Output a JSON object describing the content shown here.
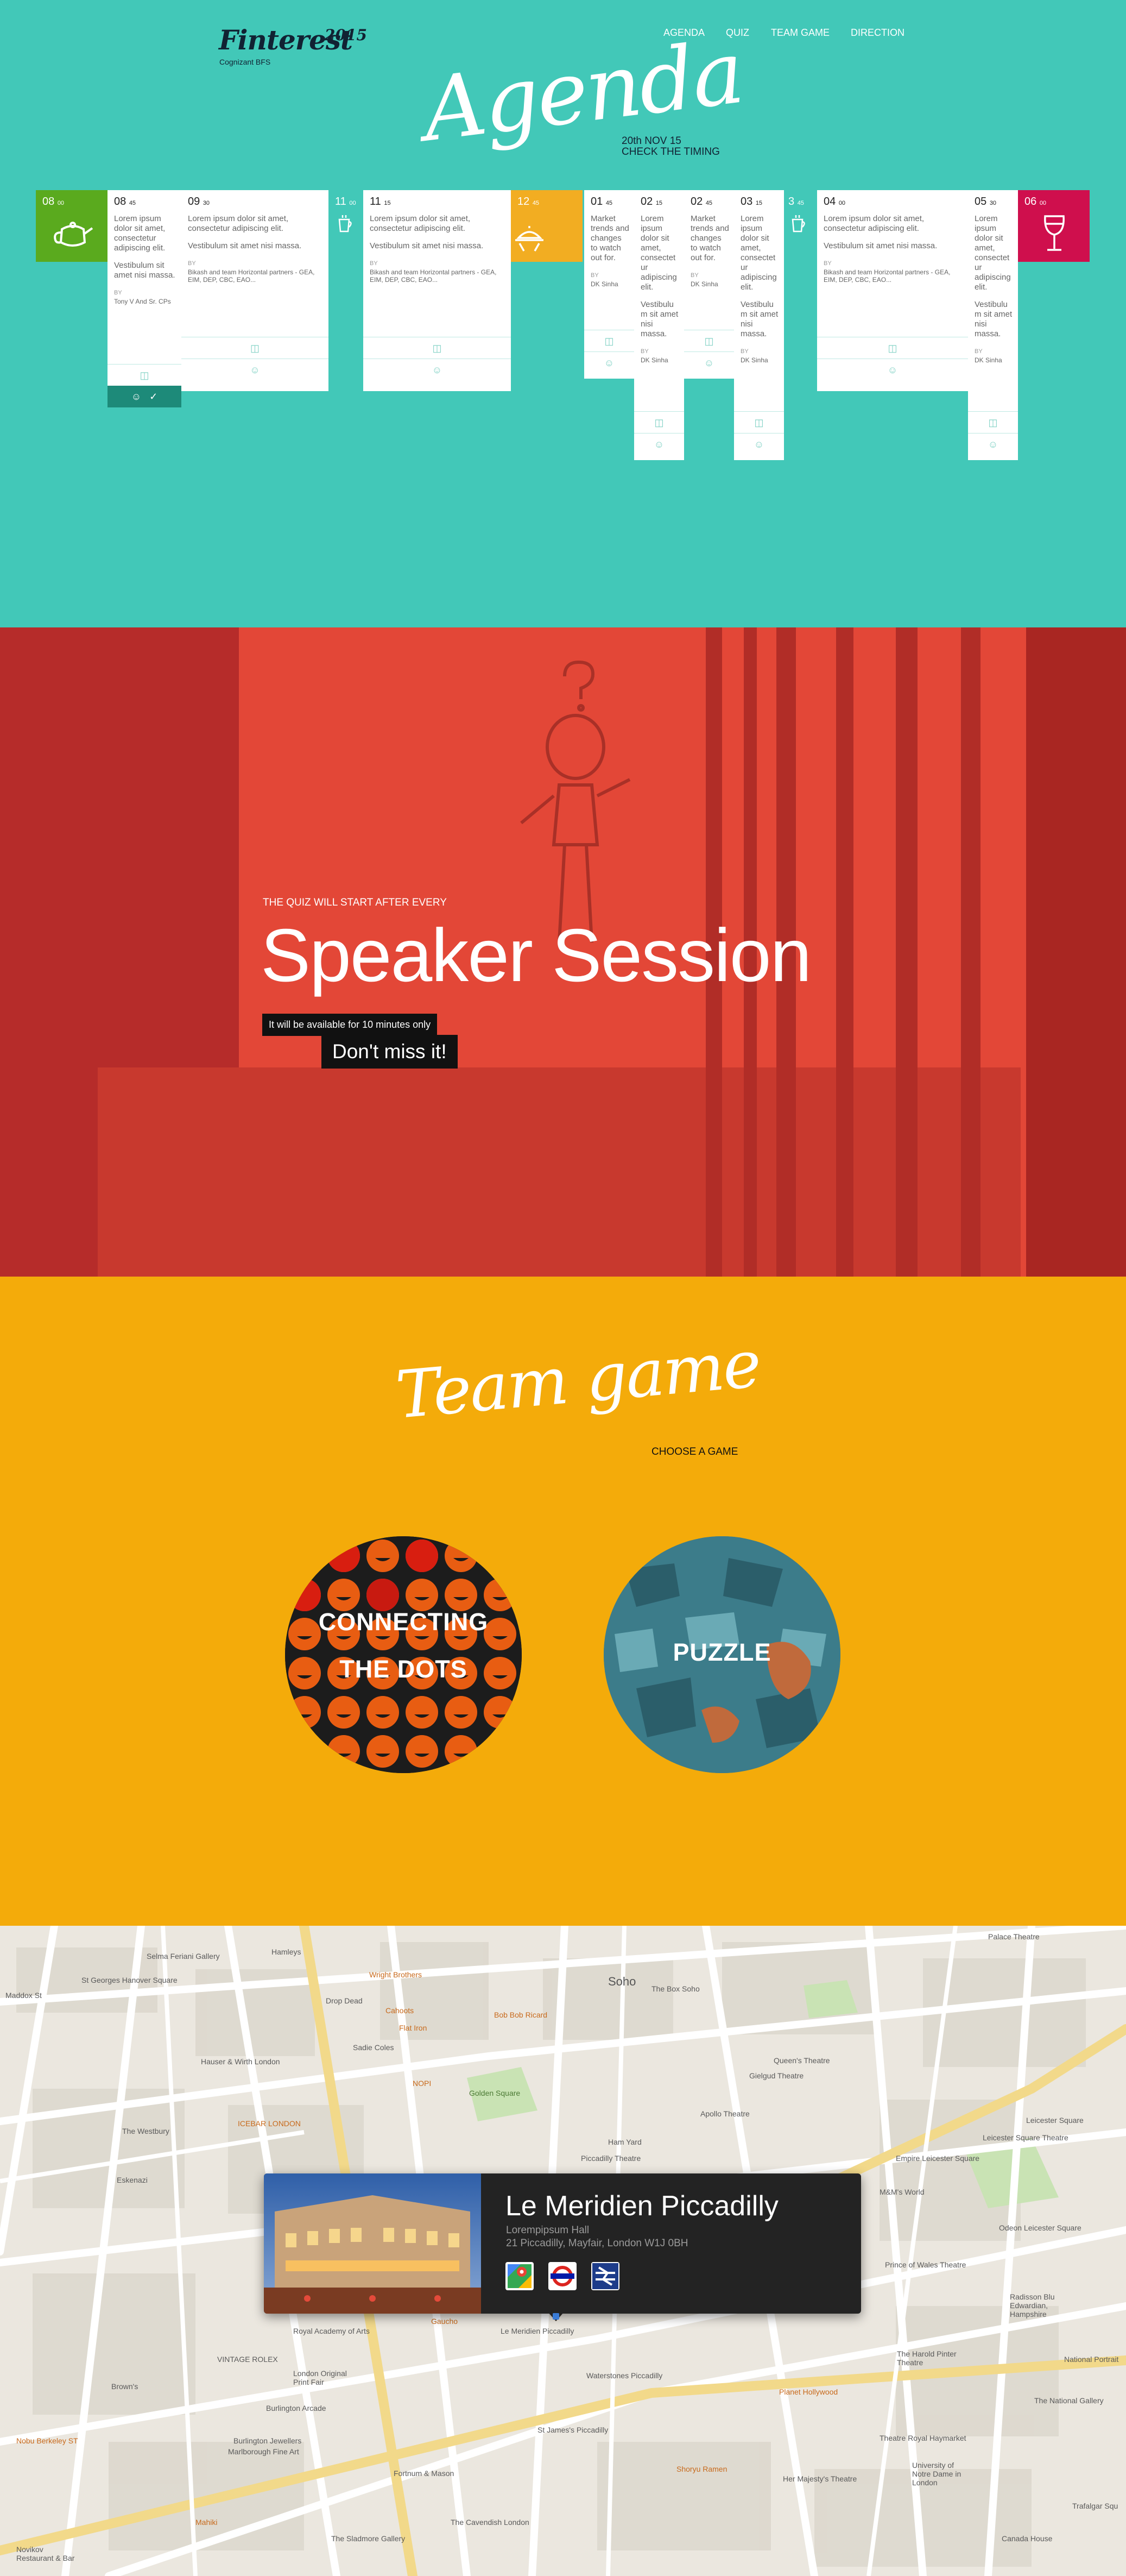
{
  "brand": {
    "logo": "Finterest",
    "year": "2015",
    "subtitle": "Cognizant BFS"
  },
  "nav": [
    "AGENDA",
    "QUIZ",
    "TEAM GAME",
    "DIRECTION"
  ],
  "agenda": {
    "title": "Agenda",
    "date_line1": "20th NOV 15",
    "date_line2": "CHECK THE TIMING",
    "breaks": [
      {
        "hour": "08",
        "min": "00",
        "icon": "teapot-icon",
        "color": "#5aaa1e"
      },
      {
        "hour": "11",
        "min": "00",
        "icon": "coffee-cup-icon"
      },
      {
        "hour": "12",
        "min": "45",
        "icon": "lunch-tray-icon",
        "color": "#f2ad22"
      },
      {
        "hour": "3",
        "min": "45",
        "icon": "coffee-cup-icon"
      },
      {
        "hour": "06",
        "min": "00",
        "icon": "wine-glass-icon",
        "color": "#cf0f4d"
      }
    ],
    "sessions": [
      {
        "hour": "08",
        "min": "45",
        "p1": "Lorem ipsum dolor sit amet, consectetur adipiscing elit.",
        "p2": "Vestibulum sit amet nisi massa.",
        "by": "BY",
        "speaker": "Tony V And Sr. CPs"
      },
      {
        "hour": "09",
        "min": "30",
        "p1": "Lorem ipsum dolor sit amet, consectetur adipiscing elit.",
        "p2": "Vestibulum sit amet nisi massa.",
        "by": "BY",
        "speaker": "Bikash and team Horizontal partners - GEA, EIM, DEP, CBC, EAO..."
      },
      {
        "hour": "11",
        "min": "15",
        "p1": "Lorem ipsum dolor sit amet, consectetur adipiscing elit.",
        "p2": "Vestibulum sit amet nisi massa.",
        "by": "BY",
        "speaker": "Bikash and team Horizontal partners - GEA, EIM, DEP, CBC, EAO..."
      },
      {
        "hour": "01",
        "min": "45",
        "p1": "Market trends and changes to watch out for.",
        "p2": "",
        "by": "BY",
        "speaker": "DK Sinha"
      },
      {
        "hour": "02",
        "min": "15",
        "p1": "Lorem ipsum dolor sit amet, consectet ur adipiscing elit.",
        "p2": "Vestibulu m sit amet nisi massa.",
        "by": "BY",
        "speaker": "DK Sinha"
      },
      {
        "hour": "02",
        "min": "45",
        "p1": "Market trends and changes to watch out for.",
        "p2": "",
        "by": "BY",
        "speaker": "DK Sinha"
      },
      {
        "hour": "03",
        "min": "15",
        "p1": "Lorem ipsum dolor sit amet, consectet ur adipiscing elit.",
        "p2": "Vestibulu m sit amet nisi massa.",
        "by": "BY",
        "speaker": "DK Sinha"
      },
      {
        "hour": "04",
        "min": "00",
        "p1": "Lorem ipsum dolor sit amet, consectetur adipiscing elit.",
        "p2": "Vestibulum sit amet nisi massa.",
        "by": "BY",
        "speaker": "Bikash and team Horizontal partners - GEA, EIM, DEP, CBC, EAO..."
      },
      {
        "hour": "05",
        "min": "30",
        "p1": "Lorem ipsum dolor sit amet, consectet ur adipiscing elit.",
        "p2": "Vestibulu m sit amet nisi massa.",
        "by": "BY",
        "speaker": "DK Sinha"
      }
    ]
  },
  "speaker_session": {
    "kicker": "THE QUIZ WILL START AFTER EVERY",
    "title": "Speaker Session",
    "note": "It will be available for 10 minutes only",
    "cta": "Don't miss it!"
  },
  "team_game": {
    "title": "Team game",
    "subtitle": "CHOOSE A GAME",
    "games": [
      {
        "line1": "CONNECTING",
        "line2": "THE DOTS"
      },
      {
        "line1": "PUZZLE"
      }
    ]
  },
  "direction": {
    "hotel_name": "Le Meridien Piccadilly",
    "hotel_line1": "Lorempipsum Hall",
    "hotel_line2": "21 Piccadilly, Mayfair, London W1J 0BH",
    "link_icons": [
      "google-maps-icon",
      "london-underground-icon",
      "national-rail-icon"
    ],
    "map_labels": [
      "Selma Feriani Gallery",
      "Hamleys",
      "St Georges Hanover Square",
      "Maddox St",
      "Wright Brothers",
      "Drop Dead",
      "Cahoots",
      "Flat Iron",
      "Bob Bob Ricard",
      "Soho",
      "The Box Soho",
      "Palace Theatre",
      "Sadie Coles",
      "Hauser & Wirth London",
      "Golden Square",
      "NOPI",
      "Queen's Theatre",
      "Gielgud Theatre",
      "Apollo Theatre",
      "The Westbury",
      "ICEBAR LONDON",
      "Eskenazi",
      "Ham Yard",
      "Piccadilly Theatre",
      "Empire Leicester Square",
      "Leicester Square Theatre",
      "Leicester Square",
      "M&M's World",
      "Odeon Leicester Square",
      "Prince of Wales Theatre",
      "Radisson Blu Edwardian, Hampshire",
      "Royal Academy of Arts",
      "Gaucho",
      "Le Meridien Piccadilly",
      "VINTAGE ROLEX",
      "London Original Print Fair",
      "Waterstones Piccadilly",
      "Burlington Arcade",
      "Brown's",
      "Burlington Jewellers",
      "Marlborough Fine Art",
      "Planet Hollywood",
      "The Harold Pinter Theatre",
      "National Portrait",
      "The National Gallery",
      "Theatre Royal Haymarket",
      "Her Majesty's Theatre",
      "University of Notre Dame in London",
      "Shoryu Ramen",
      "Fortnum & Mason",
      "St James's Piccadilly",
      "Nobu Berkeley ST",
      "The Cavendish London",
      "The Sladmore Gallery",
      "Novikov Restaurant & Bar",
      "Mahiki",
      "Canada House",
      "Trafalgar Squ"
    ]
  },
  "colors": {
    "agenda_bg": "#42c8b8",
    "speaker_bg": "#b62c2a",
    "team_bg": "#f4ab0a",
    "map_bg": "#ebe7df"
  }
}
